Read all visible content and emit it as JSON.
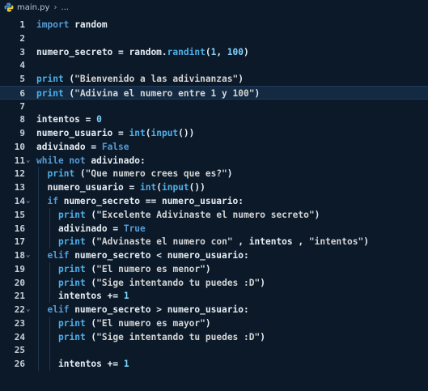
{
  "breadcrumb": {
    "file": "main.py",
    "more": "..."
  },
  "editor": {
    "current_line": 6,
    "lines": [
      {
        "num": "1",
        "fold": "",
        "indent": 0,
        "tokens": [
          [
            "kw",
            "import"
          ],
          [
            "id",
            " random"
          ]
        ]
      },
      {
        "num": "2",
        "fold": "",
        "indent": 0,
        "tokens": []
      },
      {
        "num": "3",
        "fold": "",
        "indent": 0,
        "tokens": [
          [
            "id",
            "numero_secreto = random."
          ],
          [
            "fn",
            "randint"
          ],
          [
            "id",
            "("
          ],
          [
            "num",
            "1"
          ],
          [
            "id",
            ", "
          ],
          [
            "num",
            "100"
          ],
          [
            "id",
            ")"
          ]
        ]
      },
      {
        "num": "4",
        "fold": "",
        "indent": 0,
        "tokens": []
      },
      {
        "num": "5",
        "fold": "",
        "indent": 0,
        "tokens": [
          [
            "fn",
            "print"
          ],
          [
            "id",
            " ("
          ],
          [
            "str",
            "\"Bienvenido a las adivinanzas\""
          ],
          [
            "id",
            ")"
          ]
        ]
      },
      {
        "num": "6",
        "fold": "",
        "indent": 0,
        "tokens": [
          [
            "fn",
            "print"
          ],
          [
            "id",
            " ("
          ],
          [
            "str",
            "\"Adivina el numero entre 1 y 100\""
          ],
          [
            "id",
            ")"
          ]
        ]
      },
      {
        "num": "7",
        "fold": "",
        "indent": 0,
        "tokens": []
      },
      {
        "num": "8",
        "fold": "",
        "indent": 0,
        "tokens": [
          [
            "id",
            "intentos = "
          ],
          [
            "num",
            "0"
          ]
        ]
      },
      {
        "num": "9",
        "fold": "",
        "indent": 0,
        "tokens": [
          [
            "id",
            "numero_usuario = "
          ],
          [
            "fn",
            "int"
          ],
          [
            "id",
            "("
          ],
          [
            "fn",
            "input"
          ],
          [
            "id",
            "())"
          ]
        ]
      },
      {
        "num": "10",
        "fold": "",
        "indent": 0,
        "tokens": [
          [
            "id",
            "adivinado = "
          ],
          [
            "kw",
            "False"
          ]
        ]
      },
      {
        "num": "11",
        "fold": "v",
        "indent": 0,
        "tokens": [
          [
            "kw",
            "while not"
          ],
          [
            "id",
            " adivinado:"
          ]
        ]
      },
      {
        "num": "12",
        "fold": "",
        "indent": 1,
        "tokens": [
          [
            "fn",
            "print"
          ],
          [
            "id",
            " ("
          ],
          [
            "str",
            "\"Que numero crees que es?\""
          ],
          [
            "id",
            ")"
          ]
        ]
      },
      {
        "num": "13",
        "fold": "",
        "indent": 1,
        "tokens": [
          [
            "id",
            "numero_usuario = "
          ],
          [
            "fn",
            "int"
          ],
          [
            "id",
            "("
          ],
          [
            "fn",
            "input"
          ],
          [
            "id",
            "())"
          ]
        ]
      },
      {
        "num": "14",
        "fold": "v",
        "indent": 1,
        "tokens": [
          [
            "kw",
            "if"
          ],
          [
            "id",
            " numero_secreto == numero_usuario:"
          ]
        ]
      },
      {
        "num": "15",
        "fold": "",
        "indent": 2,
        "tokens": [
          [
            "fn",
            "print"
          ],
          [
            "id",
            " ("
          ],
          [
            "str",
            "\"Excelente Adivinaste el numero secreto\""
          ],
          [
            "id",
            ")"
          ]
        ]
      },
      {
        "num": "16",
        "fold": "",
        "indent": 2,
        "tokens": [
          [
            "id",
            "adivinado = "
          ],
          [
            "kw",
            "True"
          ]
        ]
      },
      {
        "num": "17",
        "fold": "",
        "indent": 2,
        "tokens": [
          [
            "fn",
            "print"
          ],
          [
            "id",
            " ("
          ],
          [
            "str",
            "\"Advinaste el numero con\""
          ],
          [
            "id",
            " , intentos , "
          ],
          [
            "str",
            "\"intentos\""
          ],
          [
            "id",
            ")"
          ]
        ]
      },
      {
        "num": "18",
        "fold": "v",
        "indent": 1,
        "tokens": [
          [
            "kw",
            "elif"
          ],
          [
            "id",
            " numero_secreto < numero_usuario:"
          ]
        ]
      },
      {
        "num": "19",
        "fold": "",
        "indent": 2,
        "tokens": [
          [
            "fn",
            "print"
          ],
          [
            "id",
            " ("
          ],
          [
            "str",
            "\"El numero es menor\""
          ],
          [
            "id",
            ")"
          ]
        ]
      },
      {
        "num": "20",
        "fold": "",
        "indent": 2,
        "tokens": [
          [
            "fn",
            "print"
          ],
          [
            "id",
            " ("
          ],
          [
            "str",
            "\"Sige intentando tu puedes :D\""
          ],
          [
            "id",
            ")"
          ]
        ]
      },
      {
        "num": "21",
        "fold": "",
        "indent": 2,
        "tokens": [
          [
            "id",
            "intentos += "
          ],
          [
            "num",
            "1"
          ]
        ]
      },
      {
        "num": "22",
        "fold": "v",
        "indent": 1,
        "tokens": [
          [
            "kw",
            "elif"
          ],
          [
            "id",
            " numero_secreto > numero_usuario:"
          ]
        ]
      },
      {
        "num": "23",
        "fold": "",
        "indent": 2,
        "tokens": [
          [
            "fn",
            "print"
          ],
          [
            "id",
            " ("
          ],
          [
            "str",
            "\"El numero es mayor\""
          ],
          [
            "id",
            ")"
          ]
        ]
      },
      {
        "num": "24",
        "fold": "",
        "indent": 2,
        "tokens": [
          [
            "fn",
            "print"
          ],
          [
            "id",
            " ("
          ],
          [
            "str",
            "\"Sige intentando tu puedes :D\""
          ],
          [
            "id",
            ")"
          ]
        ]
      },
      {
        "num": "25",
        "fold": "",
        "indent": 2,
        "tokens": []
      },
      {
        "num": "26",
        "fold": "",
        "indent": 2,
        "tokens": [
          [
            "id",
            "intentos += "
          ],
          [
            "num",
            "1"
          ]
        ]
      }
    ]
  }
}
